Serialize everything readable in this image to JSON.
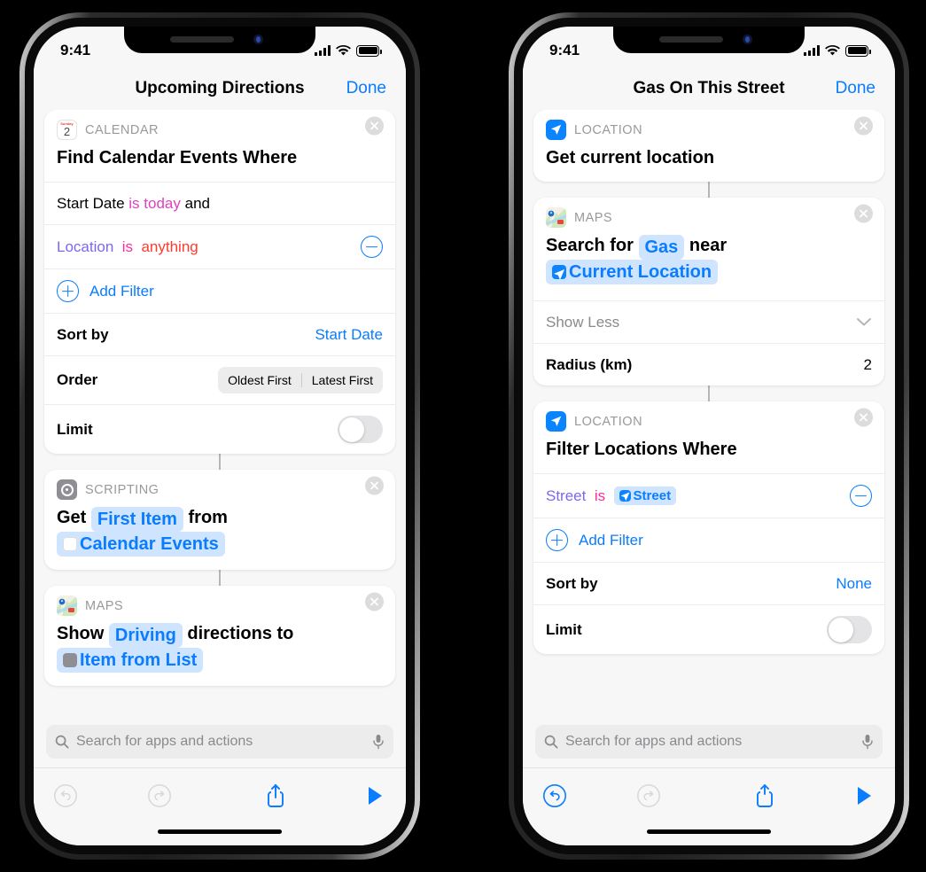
{
  "phones": [
    {
      "id": "left",
      "status_bar": {
        "time": "9:41",
        "cellular": "signal-bars-icon",
        "wifi": "wifi-icon",
        "battery": "battery-full-icon"
      },
      "nav": {
        "title": "Upcoming Directions",
        "done_label": "Done"
      },
      "cards": [
        {
          "kind": "CALENDAR",
          "icon": "calendar-icon",
          "title": "Find Calendar Events Where",
          "rows": [
            {
              "type": "filter-text",
              "parts": [
                {
                  "text": "Start Date",
                  "color": "black"
                },
                {
                  "text": "is today",
                  "color": "magenta"
                },
                {
                  "text": "and",
                  "color": "black"
                }
              ]
            },
            {
              "type": "filter-text-remove",
              "parts": [
                {
                  "text": "Location",
                  "color": "purple"
                },
                {
                  "text": "is",
                  "color": "pink"
                },
                {
                  "text": "anything",
                  "color": "red"
                }
              ],
              "action": "remove-filter"
            },
            {
              "type": "add-filter",
              "label": "Add Filter"
            },
            {
              "type": "label-value",
              "label": "Sort by",
              "value": "Start Date"
            },
            {
              "type": "segmented",
              "label": "Order",
              "options": [
                "Oldest First",
                "Latest First"
              ]
            },
            {
              "type": "toggle",
              "label": "Limit",
              "on": false
            }
          ]
        },
        {
          "kind": "SCRIPTING",
          "icon": "scripting-icon",
          "sentence": [
            {
              "text": "Get",
              "type": "plain"
            },
            {
              "text": "First Item",
              "type": "token"
            },
            {
              "text": "from",
              "type": "plain"
            },
            {
              "text": "Calendar Events",
              "type": "token",
              "icon": "calendar-icon"
            }
          ]
        },
        {
          "kind": "MAPS",
          "icon": "maps-icon",
          "sentence": [
            {
              "text": "Show",
              "type": "plain"
            },
            {
              "text": "Driving",
              "type": "token"
            },
            {
              "text": "directions to",
              "type": "plain"
            },
            {
              "text": "Item from List",
              "type": "token",
              "icon": "scripting-icon"
            }
          ]
        }
      ],
      "search": {
        "placeholder": "Search for apps and actions",
        "search_icon": "search-icon",
        "mic_icon": "microphone-icon"
      },
      "toolbar": {
        "undo": {
          "icon": "undo-icon",
          "enabled": false
        },
        "redo": {
          "icon": "redo-icon",
          "enabled": false
        },
        "share": {
          "icon": "share-icon",
          "enabled": true
        },
        "play": {
          "icon": "play-icon",
          "enabled": true
        }
      }
    },
    {
      "id": "right",
      "status_bar": {
        "time": "9:41",
        "cellular": "signal-bars-icon",
        "wifi": "wifi-icon",
        "battery": "battery-full-icon"
      },
      "nav": {
        "title": "Gas On This Street",
        "done_label": "Done"
      },
      "cards": [
        {
          "kind": "LOCATION",
          "icon": "location-icon",
          "title": "Get current location"
        },
        {
          "kind": "MAPS",
          "icon": "maps-icon",
          "sentence": [
            {
              "text": "Search for",
              "type": "plain"
            },
            {
              "text": "Gas",
              "type": "token"
            },
            {
              "text": "near",
              "type": "plain"
            },
            {
              "text": "Current Location",
              "type": "token",
              "icon": "location-icon"
            }
          ],
          "rows": [
            {
              "type": "disclosure",
              "label": "Show Less"
            },
            {
              "type": "label-value-plain",
              "label": "Radius (km)",
              "value": "2"
            }
          ]
        },
        {
          "kind": "LOCATION",
          "icon": "location-icon",
          "title": "Filter Locations Where",
          "rows": [
            {
              "type": "filter-token-remove",
              "parts": [
                {
                  "text": "Street",
                  "color": "purple"
                },
                {
                  "text": "is",
                  "color": "pink"
                }
              ],
              "token": {
                "text": "Street",
                "icon": "location-icon"
              },
              "action": "remove-filter"
            },
            {
              "type": "add-filter",
              "label": "Add Filter"
            },
            {
              "type": "label-value",
              "label": "Sort by",
              "value": "None"
            },
            {
              "type": "toggle",
              "label": "Limit",
              "on": false
            }
          ]
        }
      ],
      "search": {
        "placeholder": "Search for apps and actions",
        "search_icon": "search-icon",
        "mic_icon": "microphone-icon"
      },
      "toolbar": {
        "undo": {
          "icon": "undo-icon",
          "enabled": true
        },
        "redo": {
          "icon": "redo-icon",
          "enabled": false
        },
        "share": {
          "icon": "share-icon",
          "enabled": true
        },
        "play": {
          "icon": "play-icon",
          "enabled": true
        }
      }
    }
  ],
  "colors": {
    "accent_blue": "#0a7cff",
    "token_bg": "#cfe4ff",
    "purple": "#7b68ee",
    "pink": "#ff2d9b",
    "red": "#ff3b30",
    "magenta": "#e040c0",
    "gray_label": "#999999"
  }
}
